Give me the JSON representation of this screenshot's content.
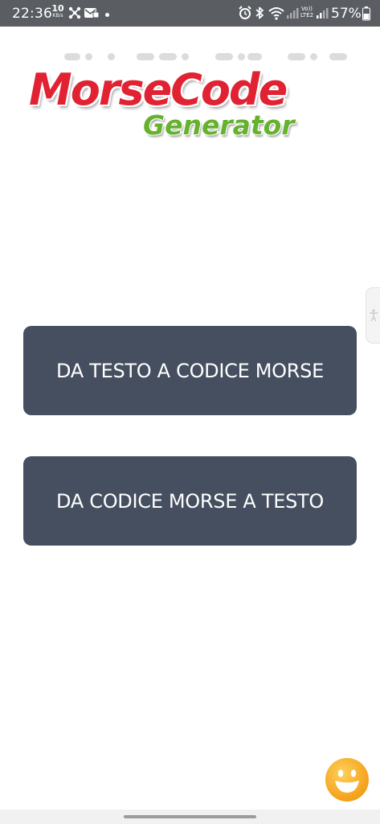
{
  "status_bar": {
    "time": "22:36",
    "net_speed_value": "10",
    "net_speed_unit": "KB/s",
    "volte_label": "Vo)) LTE2",
    "battery_percent": "57%",
    "icons": [
      "usb-icon",
      "mail-icon",
      "notification-dot",
      "alarm-icon",
      "bluetooth-icon",
      "wifi-icon",
      "signal-icon",
      "battery-icon"
    ]
  },
  "logo": {
    "title": "MorseCode",
    "subtitle": "Generator",
    "title_color": "#e02232",
    "subtitle_color": "#66b22e"
  },
  "actions": {
    "text_to_morse_label": "DA TESTO A CODICE MORSE",
    "morse_to_text_label": "DA CODICE MORSE A TESTO"
  },
  "colors": {
    "button_bg": "#454f60",
    "status_bar_bg": "#5a5d62",
    "smiley": "#f5a623"
  },
  "floating": {
    "edge_handle_icon": "accessibility-icon",
    "smiley_icon": "smiley-face-icon"
  }
}
